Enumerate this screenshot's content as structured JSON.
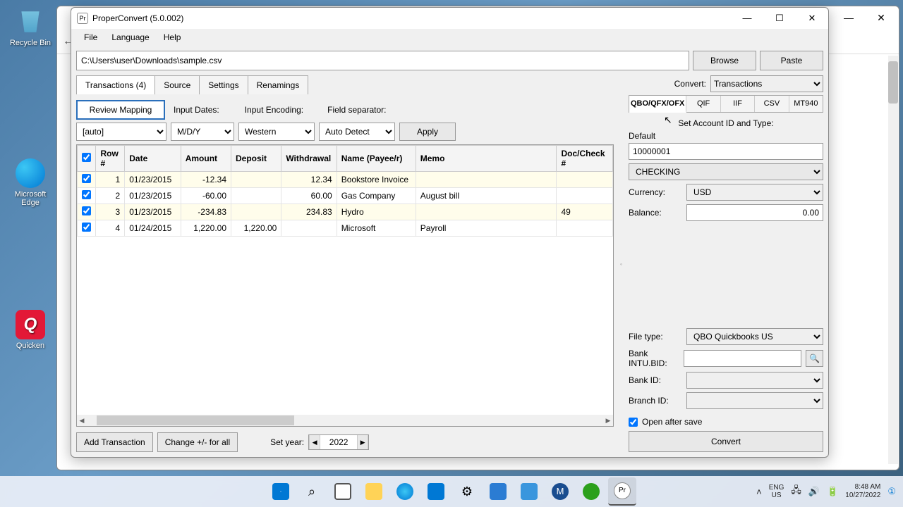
{
  "desktop": {
    "recycle": "Recycle Bin",
    "edge": "Microsoft Edge",
    "quicken": "Quicken"
  },
  "app": {
    "title": "ProperConvert (5.0.002)",
    "icon_letter": "Pr",
    "menu": {
      "file": "File",
      "language": "Language",
      "help": "Help"
    },
    "path": "C:\\Users\\user\\Downloads\\sample.csv",
    "browse": "Browse",
    "paste": "Paste",
    "tabs": {
      "transactions": "Transactions (4)",
      "source": "Source",
      "settings": "Settings",
      "renamings": "Renamings"
    },
    "toolbar": {
      "review": "Review Mapping",
      "input_dates": "Input Dates:",
      "input_encoding": "Input Encoding:",
      "field_sep": "Field separator:",
      "auto": "[auto]",
      "datefmt": "M/D/Y",
      "encoding": "Western",
      "separator": "Auto Detect",
      "apply": "Apply"
    },
    "grid": {
      "headers": {
        "row": "Row #",
        "date": "Date",
        "amount": "Amount",
        "deposit": "Deposit",
        "withdrawal": "Withdrawal",
        "name": "Name (Payee/r)",
        "memo": "Memo",
        "doc": "Doc/Check #"
      },
      "rows": [
        {
          "n": "1",
          "date": "01/23/2015",
          "amount": "-12.34",
          "deposit": "",
          "withdrawal": "12.34",
          "name": "Bookstore Invoice",
          "memo": "",
          "doc": ""
        },
        {
          "n": "2",
          "date": "01/23/2015",
          "amount": "-60.00",
          "deposit": "",
          "withdrawal": "60.00",
          "name": "Gas Company",
          "memo": "August bill",
          "doc": ""
        },
        {
          "n": "3",
          "date": "01/23/2015",
          "amount": "-234.83",
          "deposit": "",
          "withdrawal": "234.83",
          "name": "Hydro",
          "memo": "",
          "doc": "49"
        },
        {
          "n": "4",
          "date": "01/24/2015",
          "amount": "1,220.00",
          "deposit": "1,220.00",
          "withdrawal": "",
          "name": "Microsoft",
          "memo": "Payroll",
          "doc": ""
        }
      ]
    },
    "bottom": {
      "add": "Add Transaction",
      "change": "Change +/- for all",
      "setyear": "Set year:",
      "year": "2022"
    },
    "right": {
      "convert_label": "Convert:",
      "convert_sel": "Transactions",
      "formats": {
        "qbo": "QBO/QFX/OFX",
        "qif": "QIF",
        "iif": "IIF",
        "csv": "CSV",
        "mt940": "MT940"
      },
      "section": "Set Account ID and Type:",
      "default": "Default",
      "account_id": "10000001",
      "account_type": "CHECKING",
      "currency_label": "Currency:",
      "currency": "USD",
      "balance_label": "Balance:",
      "balance": "0.00",
      "filetype_label": "File type:",
      "filetype": "QBO Quickbooks US",
      "intu_label": "Bank INTU.BID:",
      "bankid_label": "Bank ID:",
      "branch_label": "Branch ID:",
      "open_after": "Open after save",
      "convert_btn": "Convert"
    }
  },
  "taskbar": {
    "lang1": "ENG",
    "lang2": "US",
    "time": "8:48 AM",
    "date": "10/27/2022"
  }
}
